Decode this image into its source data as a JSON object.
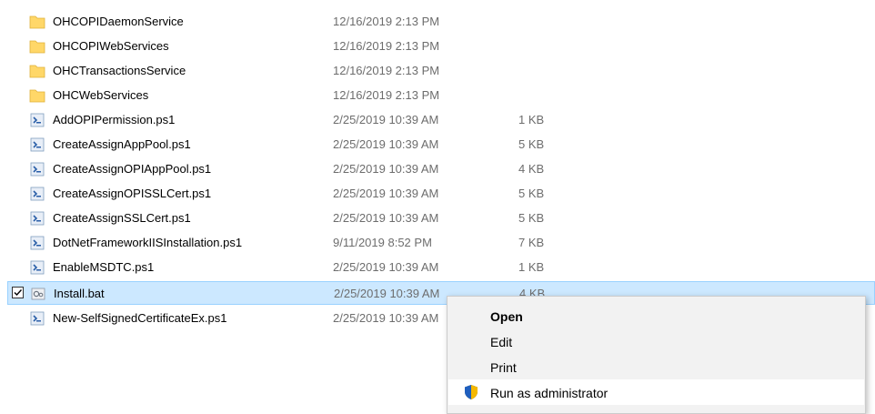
{
  "files": [
    {
      "name": "OHCOPIDaemonService",
      "date": "12/16/2019 2:13 PM",
      "size": "",
      "type": "folder"
    },
    {
      "name": "OHCOPIWebServices",
      "date": "12/16/2019 2:13 PM",
      "size": "",
      "type": "folder"
    },
    {
      "name": "OHCTransactionsService",
      "date": "12/16/2019 2:13 PM",
      "size": "",
      "type": "folder"
    },
    {
      "name": "OHCWebServices",
      "date": "12/16/2019 2:13 PM",
      "size": "",
      "type": "folder"
    },
    {
      "name": "AddOPIPermission.ps1",
      "date": "2/25/2019 10:39 AM",
      "size": "1 KB",
      "type": "ps1"
    },
    {
      "name": "CreateAssignAppPool.ps1",
      "date": "2/25/2019 10:39 AM",
      "size": "5 KB",
      "type": "ps1"
    },
    {
      "name": "CreateAssignOPIAppPool.ps1",
      "date": "2/25/2019 10:39 AM",
      "size": "4 KB",
      "type": "ps1"
    },
    {
      "name": "CreateAssignOPISSLCert.ps1",
      "date": "2/25/2019 10:39 AM",
      "size": "5 KB",
      "type": "ps1"
    },
    {
      "name": "CreateAssignSSLCert.ps1",
      "date": "2/25/2019 10:39 AM",
      "size": "5 KB",
      "type": "ps1"
    },
    {
      "name": "DotNetFrameworkIISInstallation.ps1",
      "date": "9/11/2019 8:52 PM",
      "size": "7 KB",
      "type": "ps1"
    },
    {
      "name": "EnableMSDTC.ps1",
      "date": "2/25/2019 10:39 AM",
      "size": "1 KB",
      "type": "ps1"
    },
    {
      "name": "Install.bat",
      "date": "2/25/2019 10:39 AM",
      "size": "4 KB",
      "type": "bat",
      "selected": true
    },
    {
      "name": "New-SelfSignedCertificateEx.ps1",
      "date": "2/25/2019 10:39 AM",
      "size": "",
      "type": "ps1"
    }
  ],
  "context_menu": {
    "items": [
      {
        "label": "Open",
        "bold": true
      },
      {
        "label": "Edit"
      },
      {
        "label": "Print"
      },
      {
        "label": "Run as administrator",
        "icon": "uac-shield-icon",
        "hovered": true
      }
    ]
  },
  "colors": {
    "selected_row_bg": "#cce8ff",
    "selected_row_border": "#99d1ff",
    "folder": "#ffd768",
    "menu_bg": "#f2f2f2",
    "secondary_text": "#6d6d6d"
  }
}
